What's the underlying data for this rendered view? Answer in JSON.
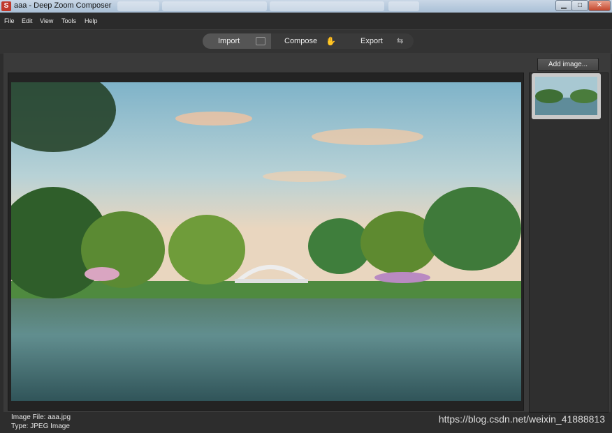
{
  "window": {
    "title": "aaa - Deep Zoom Composer",
    "controls": {
      "minimize": "▁",
      "maximize": "□",
      "close": "✕"
    }
  },
  "menu": [
    "File",
    "Edit",
    "View",
    "Tools",
    "Help"
  ],
  "toolbar": {
    "import_label": "Import",
    "compose_label": "Compose",
    "export_label": "Export"
  },
  "sidebar": {
    "add_image_label": "Add image..."
  },
  "status": {
    "file_line": "Image File: aaa.jpg",
    "type_line": "Type: JPEG Image"
  },
  "watermark": "https://blog.csdn.net/weixin_41888813",
  "colors": {
    "background": "#2d2d2d",
    "panel": "#3a3a3a",
    "active_tab": "#555555"
  }
}
